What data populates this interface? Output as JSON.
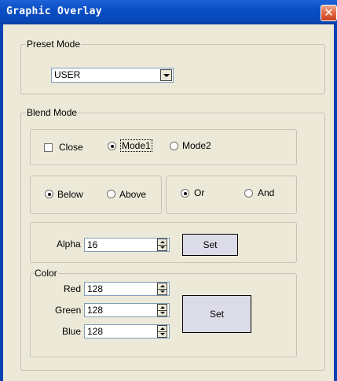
{
  "window": {
    "title": "Graphic Overlay",
    "close_glyph": "✕"
  },
  "preset": {
    "legend": "Preset Mode",
    "value": "USER"
  },
  "blend": {
    "legend": "Blend Mode",
    "close_label": "Close",
    "mode1_label": "Mode1",
    "mode2_label": "Mode2",
    "below_label": "Below",
    "above_label": "Above",
    "or_label": "Or",
    "and_label": "And",
    "alpha_label": "Alpha",
    "alpha_value": "16",
    "set_label": "Set"
  },
  "color": {
    "legend": "Color",
    "red_label": "Red",
    "red_value": "128",
    "green_label": "Green",
    "green_value": "128",
    "blue_label": "Blue",
    "blue_value": "128",
    "set_label": "Set"
  },
  "state": {
    "close_checked": false,
    "mode_selected": "Mode1",
    "position_selected": "Below",
    "logic_selected": "Or"
  },
  "colors": {
    "titlebar": "#0a4ec4",
    "dialog_bg": "#ece9d8",
    "close_button": "#e06a46",
    "frame": "#0842b5"
  }
}
